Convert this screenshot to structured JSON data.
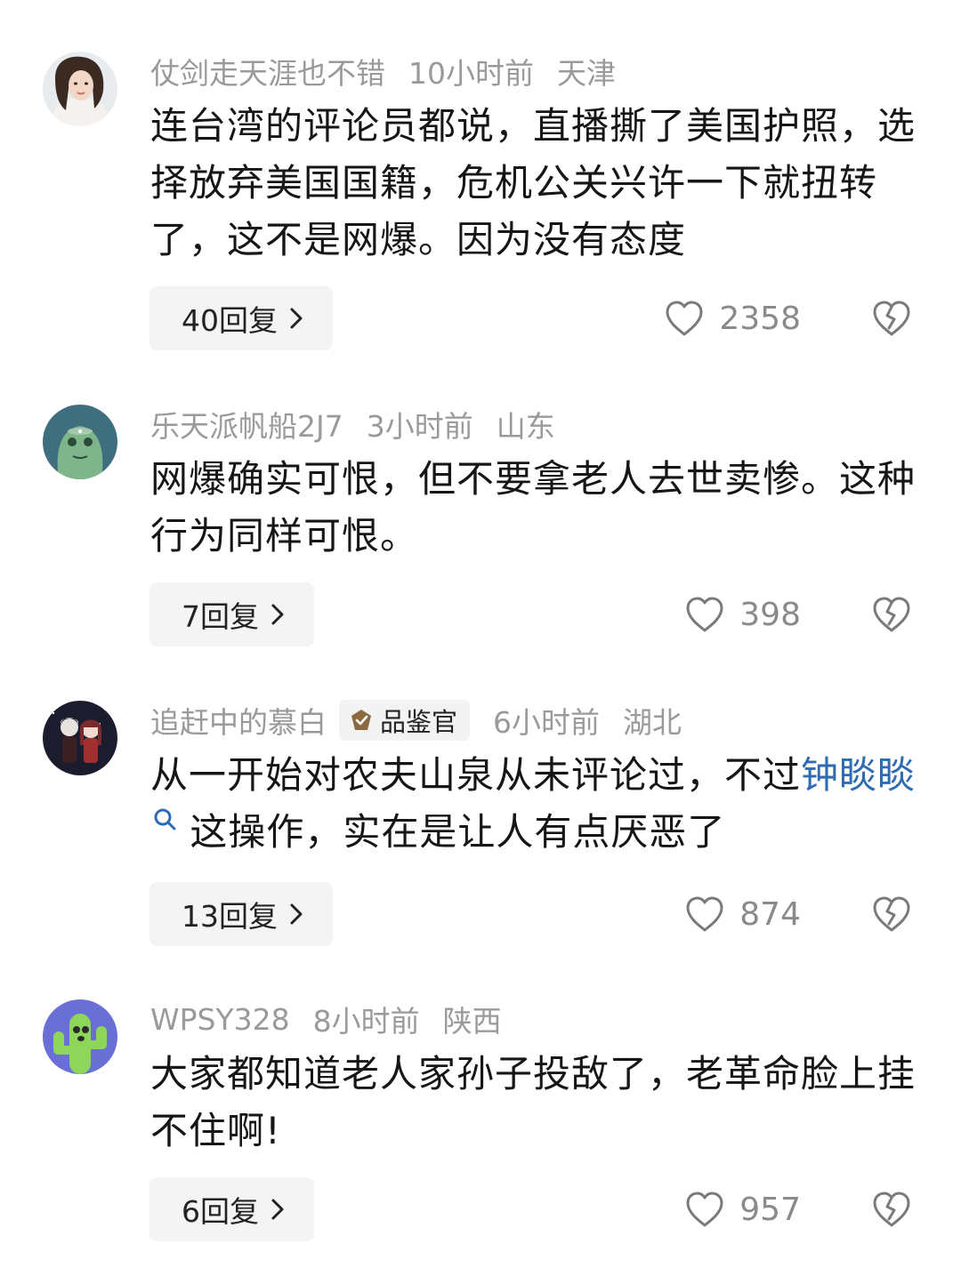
{
  "comments": [
    {
      "username": "仗剑走天涯也不错",
      "time": "10小时前",
      "location": "天津",
      "text": "连台湾的评论员都说，直播撕了美国护照，选择放弃美国国籍，危机公关兴许一下就扭转了，这不是网爆。因为没有态度",
      "replies": "40回复",
      "likes": "2358",
      "avatar_icon": "portrait-avatar"
    },
    {
      "username": "乐天派帆船2J7",
      "time": "3小时前",
      "location": "山东",
      "text": "网爆确实可恨，但不要拿老人去世卖惨。这种行为同样可恨。",
      "replies": "7回复",
      "likes": "398",
      "avatar_icon": "green-creature-avatar"
    },
    {
      "username": "追赶中的慕白",
      "badge": "品鉴官",
      "time": "6小时前",
      "location": "湖北",
      "text_before": "从一开始对农夫山泉从未评论过，不过",
      "mention": "钟睒睒",
      "text_after": "这操作，实在是让人有点厌恶了",
      "replies": "13回复",
      "likes": "874",
      "avatar_icon": "anime-couple-avatar"
    },
    {
      "username": "WPSY328",
      "time": "8小时前",
      "location": "陕西",
      "text": "大家都知道老人家孙子投敌了，老革命脸上挂不住啊!",
      "replies": "6回复",
      "likes": "957",
      "avatar_icon": "cactus-avatar"
    }
  ],
  "colors": {
    "meta": "#9a9a9a",
    "mention": "#2f6bb2",
    "reply_bg": "#f4f4f4"
  }
}
